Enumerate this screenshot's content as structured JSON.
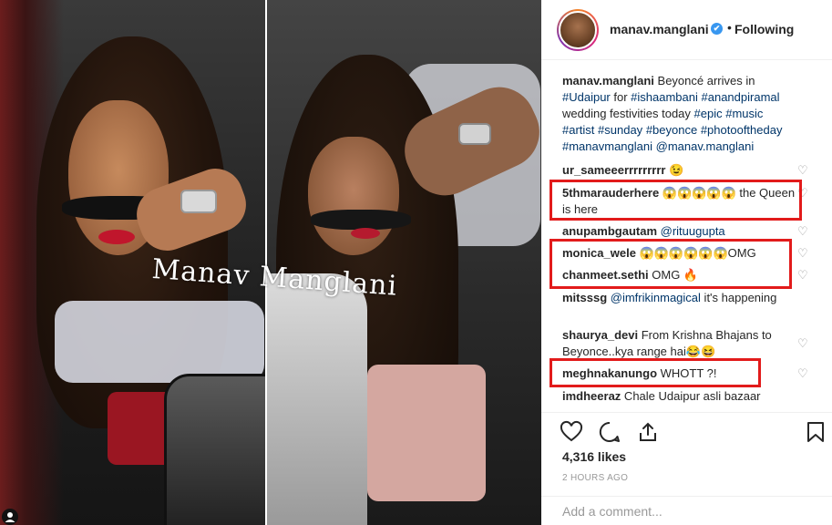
{
  "header": {
    "username": "manav.manglani",
    "verified_mark": "✔",
    "separator": "•",
    "follow_status": "Following"
  },
  "photo": {
    "watermark": "Manav Manglani"
  },
  "caption": {
    "username": "manav.manglani",
    "line1": "Beyoncé arrives in",
    "hashtag1": "#Udaipur",
    "mid1": " for ",
    "hashtag2": "#ishaambani",
    "hashtag3": "#anandpiramal",
    "line3": "wedding festivities today ",
    "hashtag4": "#epic",
    "hashtag5": "#music",
    "hashtag6": "#artist",
    "hashtag7": "#sunday",
    "hashtag8": "#beyonce",
    "hashtag9": "#photooftheday",
    "hashtag10": "#manavmanglani",
    "mention": "@manav.manglani"
  },
  "comments": [
    {
      "user": "ur_sameeerrrrrrrrr",
      "text": " 😉"
    },
    {
      "user": "5thmarauderhere",
      "text": " 😱😱😱😱😱 the Queen is here"
    },
    {
      "user": "anupambgautam",
      "mention": "@rituugupta"
    },
    {
      "user": "monica_wele",
      "text": " 😱😱😱😱😱😱OMG"
    },
    {
      "user": "chanmeet.sethi",
      "text": " OMG 🔥"
    },
    {
      "user": "mitsssg",
      "mention": "@imfrikinmagical",
      "text": " it's happening"
    },
    {
      "user": "shaurya_devi",
      "text": " From Krishna Bhajans to Beyonce..kya range hai😂😆"
    },
    {
      "user": "meghnakanungo",
      "text": " WHOTT ?!"
    },
    {
      "user": "imdheeraz",
      "text": " Chale Udaipur asli bazaar"
    }
  ],
  "actions": {
    "likes": "4,316 likes",
    "time": "2 HOURS AGO"
  },
  "add_comment": {
    "placeholder": "Add a comment..."
  },
  "icons": {
    "heart": "heart-icon",
    "comment": "comment-icon",
    "share": "share-icon",
    "save": "bookmark-icon",
    "small_heart": "♡"
  },
  "colors": {
    "highlight": "#e21b1b",
    "link": "#003569",
    "verified": "#3897f0"
  }
}
